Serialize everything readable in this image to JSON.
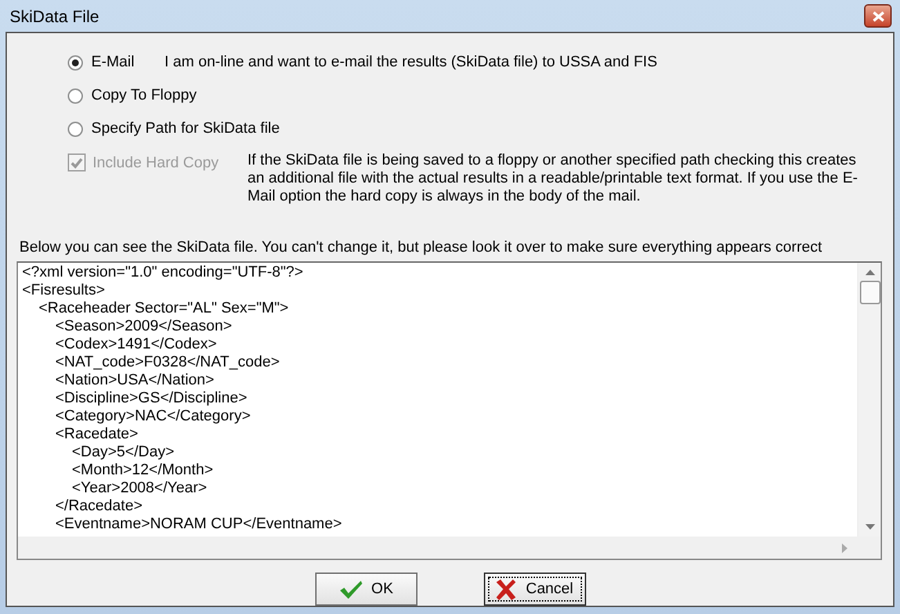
{
  "window": {
    "title": "SkiData File"
  },
  "options": [
    {
      "label": "E-Mail",
      "selected": true,
      "description": "I am on-line and want to e-mail the results (SkiData file) to USSA and FIS"
    },
    {
      "label": "Copy To Floppy",
      "selected": false
    },
    {
      "label": "Specify Path for SkiData file",
      "selected": false
    }
  ],
  "hard_copy": {
    "label": "Include Hard Copy",
    "checked": true,
    "disabled": true,
    "description": "If the SkiData file is being saved to a floppy or another specified path checking this creates an additional file with the actual results in a readable/printable text format. If you use the E-Mail option the hard copy is always in the body of the mail."
  },
  "preview_label": "Below you can see the SkiData file. You can't change it, but please look it over to make sure everything appears correct",
  "file_lines": [
    {
      "text": "<?xml version=\"1.0\" encoding=\"UTF-8\"?>"
    },
    {
      "text": "<Fisresults>",
      "children": [
        {
          "text": "<Raceheader Sector=\"AL\" Sex=\"M\">",
          "children": [
            {
              "text": "<Season>2009</Season>"
            },
            {
              "text": "<Codex>1491</Codex>"
            },
            {
              "text": "<NAT_code>F0328</NAT_code>"
            },
            {
              "text": "<Nation>USA</Nation>"
            },
            {
              "text": "<Discipline>GS</Discipline>"
            },
            {
              "text": "<Category>NAC</Category>"
            },
            {
              "text": "<Racedate>",
              "children": [
                {
                  "text": "<Day>5</Day>"
                },
                {
                  "text": "<Month>12</Month>"
                },
                {
                  "text": "<Year>2008</Year>"
                }
              ]
            },
            {
              "text": "</Racedate>"
            },
            {
              "text": "<Eventname>NORAM CUP</Eventname>"
            }
          ]
        }
      ]
    }
  ],
  "buttons": [
    {
      "kind": "ok",
      "label": "OK"
    },
    {
      "kind": "cancel",
      "label": "Cancel"
    }
  ]
}
